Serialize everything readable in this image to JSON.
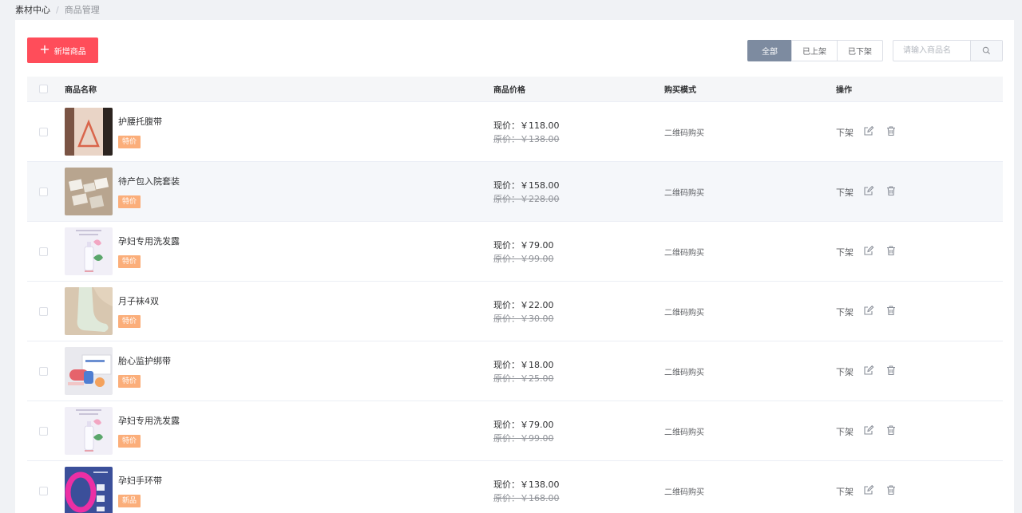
{
  "breadcrumb": {
    "root": "素材中心",
    "separator": "/",
    "current": "商品管理"
  },
  "toolbar": {
    "add_label": "新增商品"
  },
  "filter_tabs": [
    {
      "label": "全部",
      "active": true
    },
    {
      "label": "已上架",
      "active": false
    },
    {
      "label": "已下架",
      "active": false
    }
  ],
  "search": {
    "placeholder": "请输入商品名",
    "icon": "search-icon"
  },
  "table": {
    "headers": {
      "name": "商品名称",
      "price": "商品价格",
      "mode": "购买模式",
      "op": "操作"
    },
    "rows": [
      {
        "name": "护腰托腹带",
        "tag": "特价",
        "now": "现价：￥118.00",
        "old": "原价：￥138.00",
        "mode": "二维码购买",
        "off": "下架"
      },
      {
        "name": "待产包入院套装",
        "tag": "特价",
        "now": "现价：￥158.00",
        "old": "原价：￥228.00",
        "mode": "二维码购买",
        "off": "下架"
      },
      {
        "name": "孕妇专用洗发露",
        "tag": "特价",
        "now": "现价：￥79.00",
        "old": "原价：￥99.00",
        "mode": "二维码购买",
        "off": "下架"
      },
      {
        "name": "月子袜4双",
        "tag": "特价",
        "now": "现价：￥22.00",
        "old": "原价：￥30.00",
        "mode": "二维码购买",
        "off": "下架"
      },
      {
        "name": "胎心监护绑带",
        "tag": "特价",
        "now": "现价：￥18.00",
        "old": "原价：￥25.00",
        "mode": "二维码购买",
        "off": "下架"
      },
      {
        "name": "孕妇专用洗发露",
        "tag": "特价",
        "now": "现价：￥79.00",
        "old": "原价：￥99.00",
        "mode": "二维码购买",
        "off": "下架"
      },
      {
        "name": "孕妇手环带",
        "tag": "新品",
        "now": "现价：￥138.00",
        "old": "原价：￥168.00",
        "mode": "二维码购买",
        "off": "下架"
      }
    ]
  },
  "colors": {
    "primary": "#ff4d5a",
    "tab_active": "#7d8ba0",
    "tag": "#fbae7a"
  }
}
